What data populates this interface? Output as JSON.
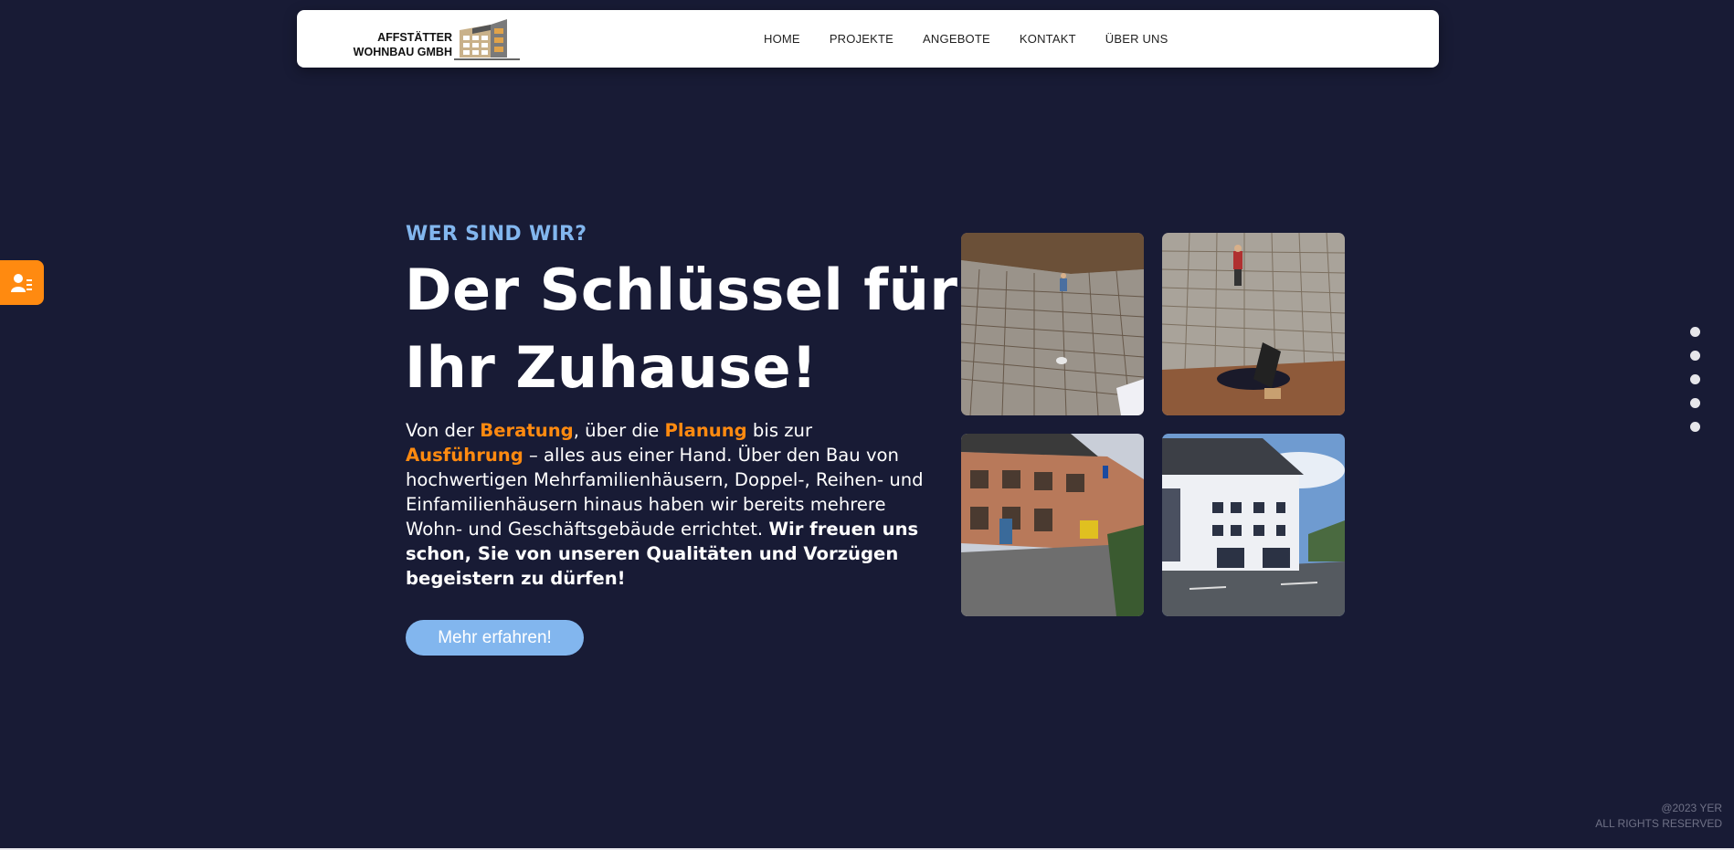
{
  "brand": {
    "name_line1": "AFFSTÄTTER",
    "name_line2": "WOHNBAU GMBH"
  },
  "nav": {
    "items": [
      "HOME",
      "PROJEKTE",
      "ANGEBOTE",
      "KONTAKT",
      "ÜBER UNS"
    ]
  },
  "hero": {
    "kicker": "WER SIND WIR?",
    "headline_line1": "Der Schlüssel für",
    "headline_line2": "Ihr Zuhause!",
    "body": {
      "p1": "Von der ",
      "h1": "Beratung",
      "p2": ", über die ",
      "h2": "Planung",
      "p3": " bis zur ",
      "h3": "Ausführung",
      "p4": " – alles aus einer Hand. Über den Bau von hochwertigen Mehrfamilienhäusern, Doppel-, Reihen- und Einfamilienhäusern hinaus haben wir bereits mehrere Wohn- und Geschäftsgebäude errichtet. ",
      "strong": "Wir freuen uns schon, Sie von unseren Qualitäten und Vorzügen begeistern zu dürfen!"
    },
    "cta_label": "Mehr erfahren!"
  },
  "gallery": {
    "photos": [
      "construction-rebar-foundation-photo",
      "construction-worker-rebar-photo",
      "rowhouse-construction-site-photo",
      "finished-white-house-photo"
    ]
  },
  "side_button": {
    "icon": "contact-person-icon"
  },
  "section_dots": {
    "count": 5
  },
  "footer": {
    "copyright": "@2023 YER",
    "rights": "ALL RIGHTS RESERVED"
  },
  "colors": {
    "background": "#181b35",
    "accent_orange": "#ff8a10",
    "accent_blue": "#82b6ee",
    "navbar_bg": "#ffffff"
  }
}
